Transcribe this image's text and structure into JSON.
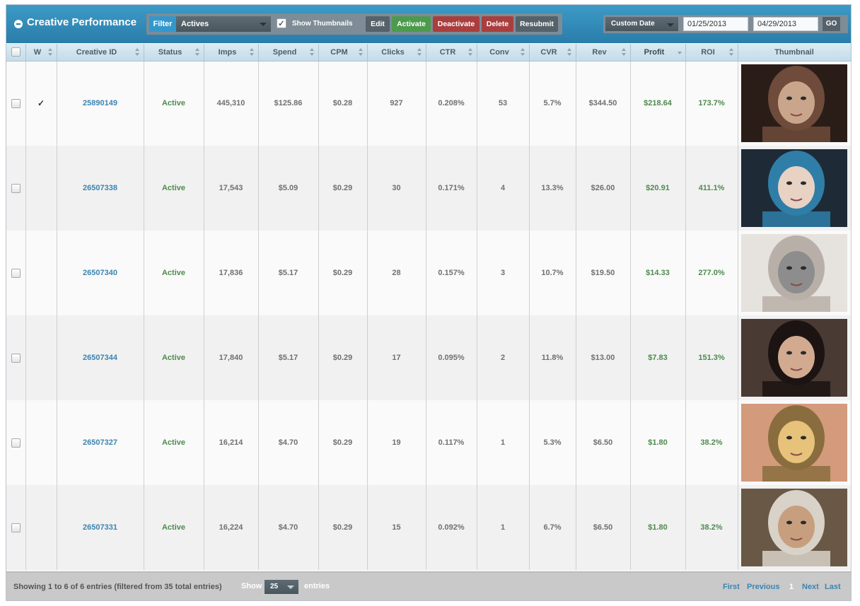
{
  "header": {
    "title": "Creative Performance",
    "filter_label": "Filter",
    "filter_value": "Actives",
    "show_thumbnails_checked": true,
    "show_thumbnails_label": "Show Thumbnails",
    "buttons": {
      "edit": "Edit",
      "activate": "Activate",
      "deactivate": "Deactivate",
      "delete": "Delete",
      "resubmit": "Resubmit"
    },
    "date_mode": "Custom Date",
    "start_date": "01/25/2013",
    "end_date": "04/29/2013",
    "go": "GO"
  },
  "colors": {
    "header_blue": "#2a7daa",
    "activate_green": "#4d9a4d",
    "danger_red": "#a93e3e",
    "link_blue": "#3b84b0",
    "positive_green": "#4e8a4e"
  },
  "table": {
    "columns": [
      "W",
      "Creative ID",
      "Status",
      "Imps",
      "Spend",
      "CPM",
      "Clicks",
      "CTR",
      "Conv",
      "CVR",
      "Rev",
      "Profit",
      "ROI",
      "Thumbnail"
    ],
    "rows": [
      {
        "w": "✓",
        "id": "25890149",
        "status": "Active",
        "imps": "445,310",
        "spend": "$125.86",
        "cpm": "$0.28",
        "clicks": "927",
        "ctr": "0.208%",
        "conv": "53",
        "cvr": "5.7%",
        "rev": "$344.50",
        "profit": "$218.64",
        "roi": "173.7%",
        "thumb": "photo-woman-lying-dark-hair"
      },
      {
        "w": "",
        "id": "26507338",
        "status": "Active",
        "imps": "17,543",
        "spend": "$5.09",
        "cpm": "$0.29",
        "clicks": "30",
        "ctr": "0.171%",
        "conv": "4",
        "cvr": "13.3%",
        "rev": "$26.00",
        "profit": "$20.91",
        "roi": "411.1%",
        "thumb": "photo-woman-blue-hair"
      },
      {
        "w": "",
        "id": "26507340",
        "status": "Active",
        "imps": "17,836",
        "spend": "$5.17",
        "cpm": "$0.29",
        "clicks": "28",
        "ctr": "0.157%",
        "conv": "3",
        "cvr": "10.7%",
        "rev": "$19.50",
        "profit": "$14.33",
        "roi": "277.0%",
        "thumb": "photo-woman-grey-top"
      },
      {
        "w": "",
        "id": "26507344",
        "status": "Active",
        "imps": "17,840",
        "spend": "$5.17",
        "cpm": "$0.29",
        "clicks": "17",
        "ctr": "0.095%",
        "conv": "2",
        "cvr": "11.8%",
        "rev": "$13.00",
        "profit": "$7.83",
        "roi": "151.3%",
        "thumb": "photo-woman-dark-hair-portrait"
      },
      {
        "w": "",
        "id": "26507327",
        "status": "Active",
        "imps": "16,214",
        "spend": "$4.70",
        "cpm": "$0.29",
        "clicks": "19",
        "ctr": "0.117%",
        "conv": "1",
        "cvr": "5.3%",
        "rev": "$6.50",
        "profit": "$1.80",
        "roi": "38.2%",
        "thumb": "photo-woman-blonde-braid"
      },
      {
        "w": "",
        "id": "26507331",
        "status": "Active",
        "imps": "16,224",
        "spend": "$4.70",
        "cpm": "$0.29",
        "clicks": "15",
        "ctr": "0.092%",
        "conv": "1",
        "cvr": "6.7%",
        "rev": "$6.50",
        "profit": "$1.80",
        "roi": "38.2%",
        "thumb": "photo-woman-sunglasses-selfie"
      }
    ]
  },
  "footer": {
    "info": "Showing 1 to 6 of 6 entries (filtered from 35 total entries)",
    "show_label": "Show",
    "page_size": "25",
    "entries_label": "entries",
    "pager": {
      "first": "First",
      "previous": "Previous",
      "current": "1",
      "next": "Next",
      "last": "Last"
    }
  }
}
